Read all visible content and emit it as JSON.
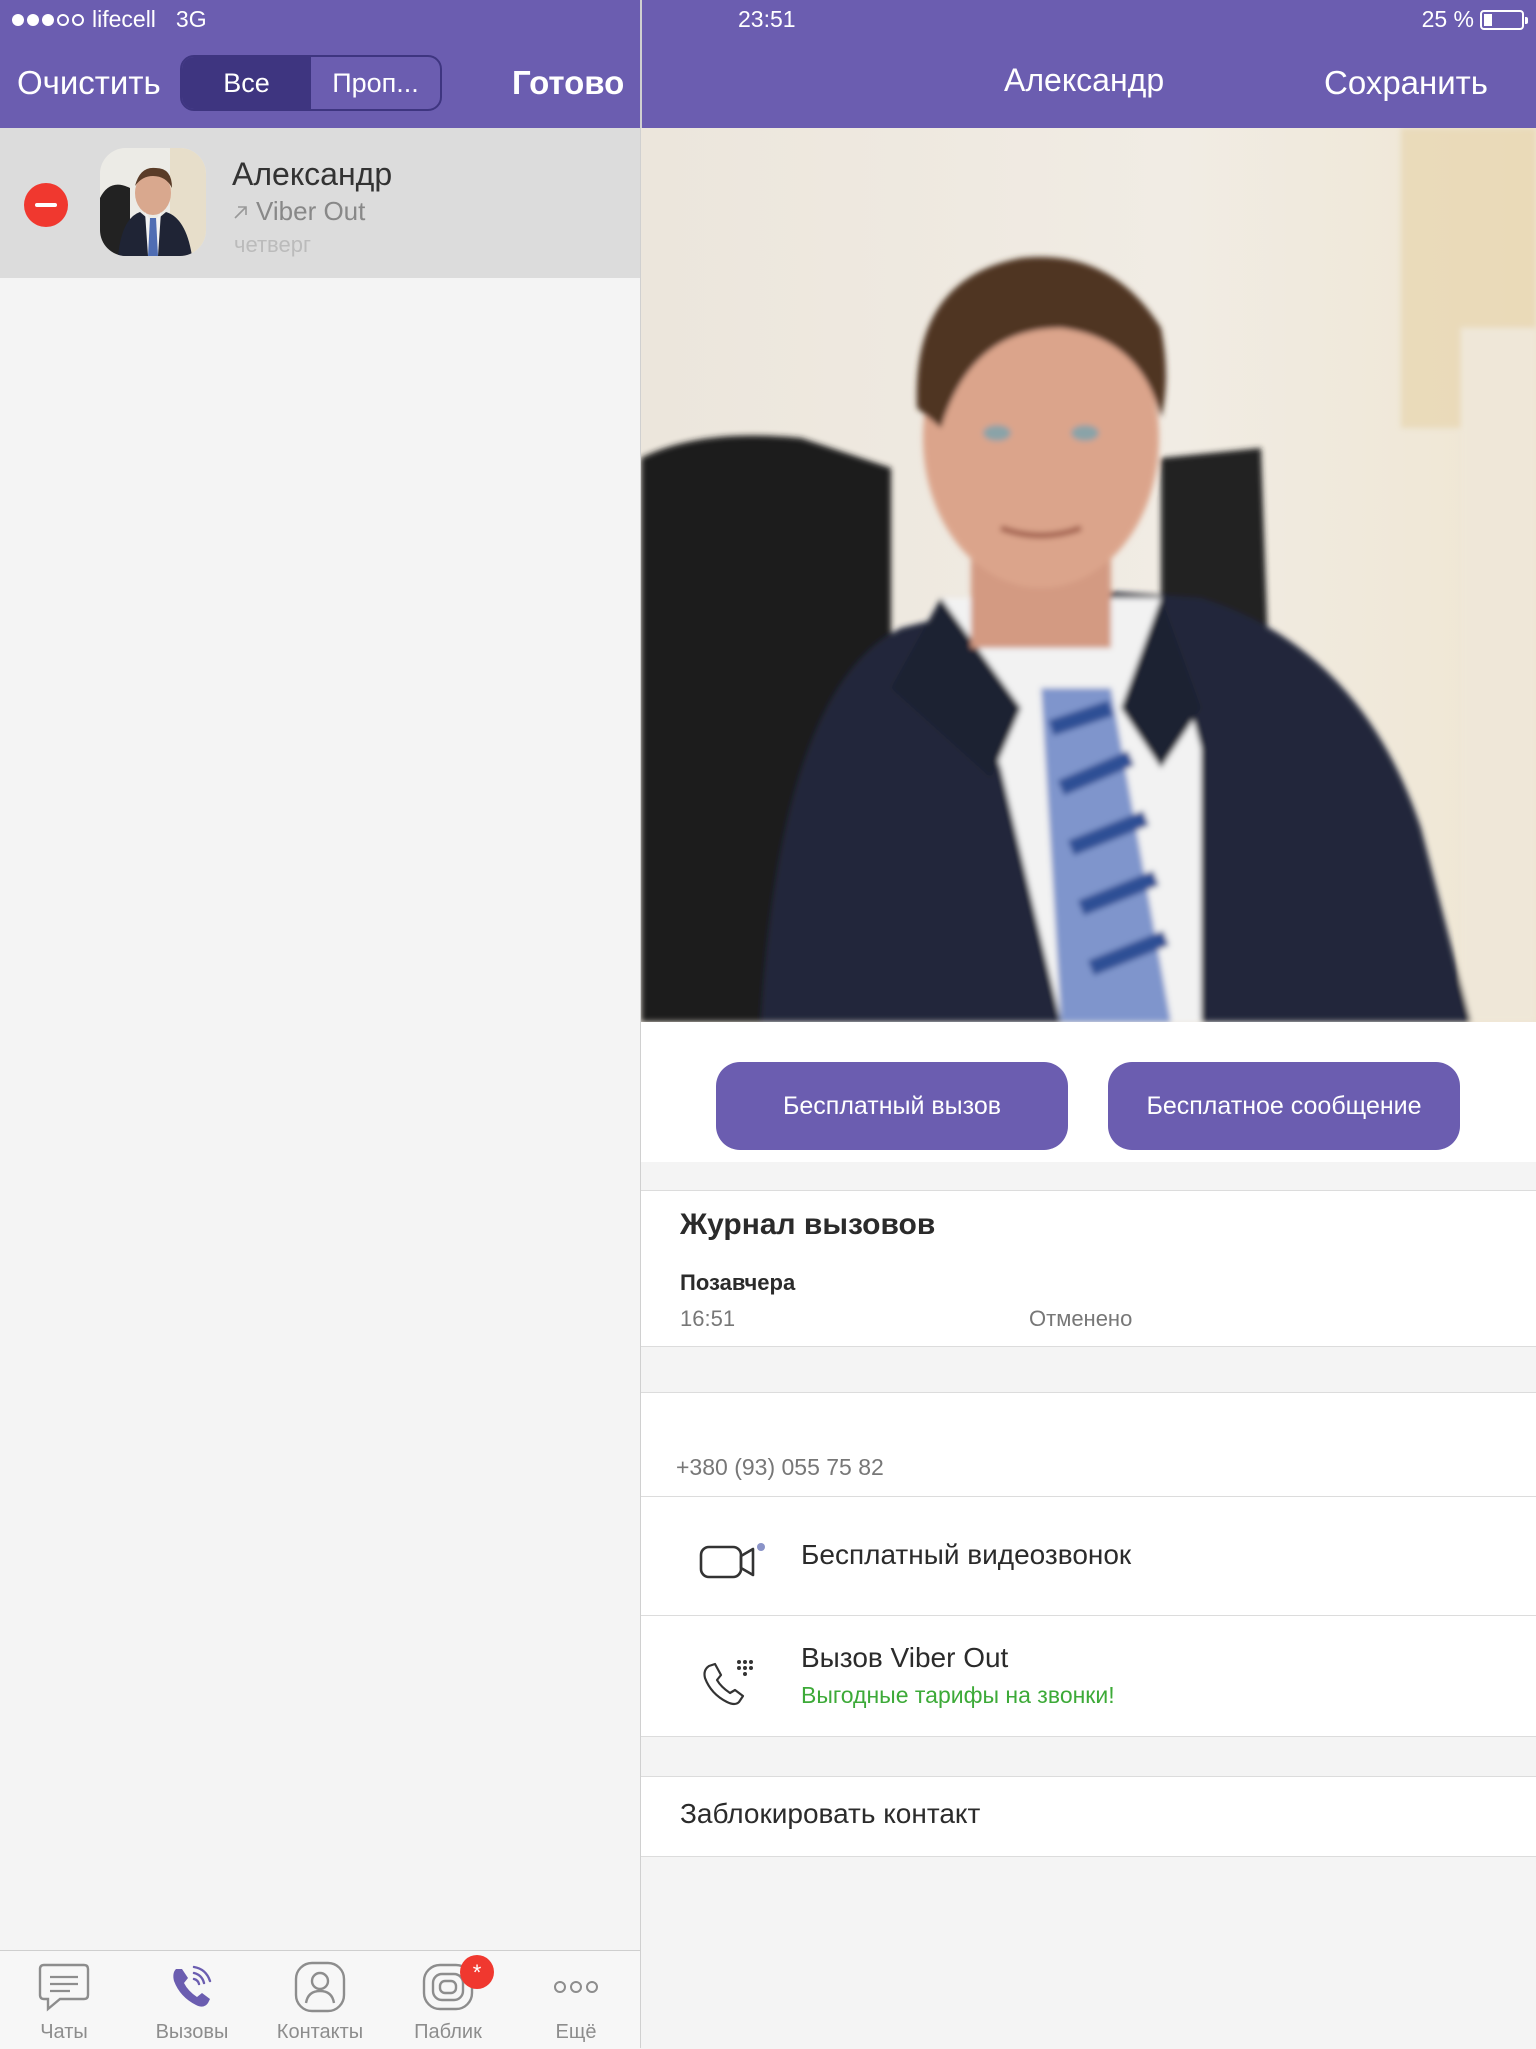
{
  "status_bar": {
    "carrier": "lifecell",
    "network": "3G",
    "time": "23:51",
    "battery": "25 %"
  },
  "left_nav": {
    "clear_label": "Очистить",
    "segments": [
      "Все",
      "Проп..."
    ],
    "done_label": "Готово"
  },
  "right_nav": {
    "title": "Александр",
    "save_label": "Сохранить"
  },
  "recents": [
    {
      "name": "Александр",
      "type": "Viber Out",
      "day": "четверг"
    }
  ],
  "tabs": [
    {
      "label": "Чаты",
      "icon": "chat-icon"
    },
    {
      "label": "Вызовы",
      "icon": "phone-icon"
    },
    {
      "label": "Контакты",
      "icon": "contact-icon"
    },
    {
      "label": "Паблик",
      "icon": "public-icon"
    },
    {
      "label": "Ещё",
      "icon": "more-icon"
    }
  ],
  "public_badge": "*",
  "contact": {
    "free_call": "Бесплатный вызов",
    "free_message": "Бесплатное сообщение",
    "call_log_title": "Журнал вызовов",
    "call_log": {
      "date": "Позавчера",
      "time": "16:51",
      "status": "Отменено"
    },
    "phone": "+380 (93) 055 75 82",
    "video_call": "Бесплатный видеозвонок",
    "viber_out_title": "Вызов Viber Out",
    "viber_out_sub": "Выгодные тарифы на звонки!",
    "block": "Заблокировать контакт"
  },
  "colors": {
    "brand": "#6b5db0",
    "segment_active": "#3e3580",
    "delete": "#f0382f",
    "promo_green": "#3daa38"
  }
}
